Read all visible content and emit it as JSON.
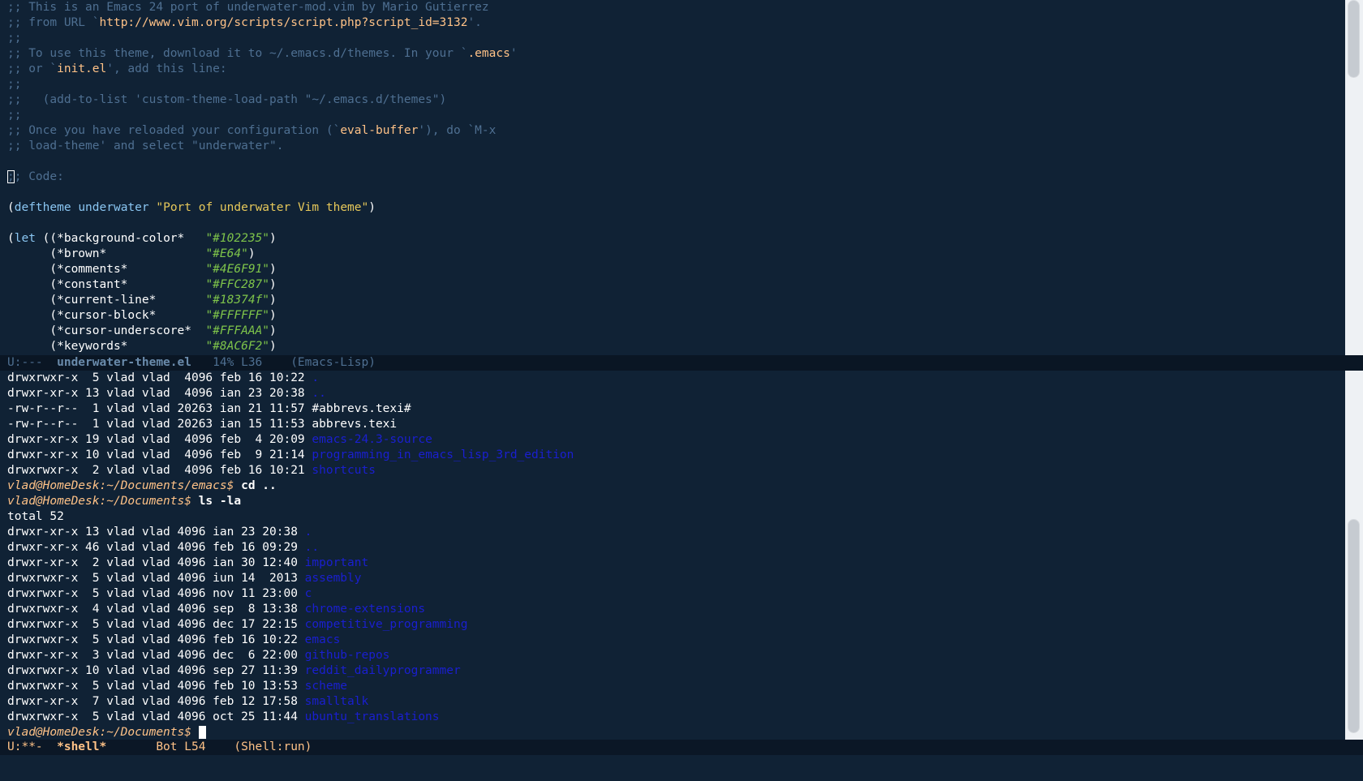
{
  "editor": {
    "lines": {
      "l1": ";; This is an Emacs 24 port of underwater-mod.vim by Mario Gutierrez",
      "l2a": ";; from URL `",
      "l2b": "http://www.vim.org/scripts/script.php?script_id=3132",
      "l2c": "'.",
      "l3": ";;",
      "l4a": ";; To use this theme, download it to ~/.emacs.d/themes. In your `",
      "l4b": ".emacs",
      "l4c": "'",
      "l5a": ";; or `",
      "l5b": "init.el",
      "l5c": "', add this line:",
      "l6": ";;",
      "l7": ";;   (add-to-list 'custom-theme-load-path \"~/.emacs.d/themes\")",
      "l8": ";;",
      "l9a": ";; Once you have reloaded your configuration (`",
      "l9b": "eval-buffer",
      "l9c": "'), do `M-x",
      "l10": ";; load-theme' and select \"underwater\".",
      "l11": "",
      "l12cur": ";",
      "l12": "; Code:",
      "l13": "",
      "l14a": "(",
      "l14b": "deftheme",
      "l14c": " ",
      "l14d": "underwater",
      "l14e": " ",
      "l14f": "\"Port of underwater Vim theme\"",
      "l14g": ")",
      "l15": "",
      "l16a": "(",
      "l16b": "let",
      "l16c": " ((*background-color*   ",
      "l16d": "\"#102235\"",
      "l16e": ")",
      "l17a": "      (*brown*              ",
      "l17b": "\"#E64\"",
      "l17c": ")",
      "l18a": "      (*comments*           ",
      "l18b": "\"#4E6F91\"",
      "l18c": ")",
      "l19a": "      (*constant*           ",
      "l19b": "\"#FFC287\"",
      "l19c": ")",
      "l20a": "      (*current-line*       ",
      "l20b": "\"#18374f\"",
      "l20c": ")",
      "l21a": "      (*cursor-block*       ",
      "l21b": "\"#FFFFFF\"",
      "l21c": ")",
      "l22a": "      (*cursor-underscore*  ",
      "l22b": "\"#FFFAAA\"",
      "l22c": ")",
      "l23a": "      (*keywords*           ",
      "l23b": "\"#8AC6F2\"",
      "l23c": ")"
    },
    "modeline": {
      "status": "U:---  ",
      "buffer": "underwater-theme.el",
      "position": "   14% L36    ",
      "mode": "(Emacs-Lisp)"
    }
  },
  "shell": {
    "lines": {
      "s1a": "drwxrwxr-x  5 vlad vlad  4096 feb 16 10:22 ",
      "s1b": ".",
      "s2a": "drwxr-xr-x 13 vlad vlad  4096 ian 23 20:38 ",
      "s2b": "..",
      "s3": "-rw-r--r--  1 vlad vlad 20263 ian 21 11:57 #abbrevs.texi#",
      "s4": "-rw-r--r--  1 vlad vlad 20263 ian 15 11:53 abbrevs.texi",
      "s5a": "drwxr-xr-x 19 vlad vlad  4096 feb  4 20:09 ",
      "s5b": "emacs-24.3-source",
      "s6a": "drwxr-xr-x 10 vlad vlad  4096 feb  9 21:14 ",
      "s6b": "programming_in_emacs_lisp_3rd_edition",
      "s7a": "drwxrwxr-x  2 vlad vlad  4096 feb 16 10:21 ",
      "s7b": "shortcuts",
      "s8a": "vlad@HomeDesk:~/Documents/emacs$ ",
      "s8b": "cd ..",
      "s9a": "vlad@HomeDesk:~/Documents$ ",
      "s9b": "ls -la",
      "s10": "total 52",
      "s11a": "drwxr-xr-x 13 vlad vlad 4096 ian 23 20:38 ",
      "s11b": ".",
      "s12a": "drwxr-xr-x 46 vlad vlad 4096 feb 16 09:29 ",
      "s12b": "..",
      "s13a": "drwxr-xr-x  2 vlad vlad 4096 ian 30 12:40 ",
      "s13b": "important",
      "s14a": "drwxrwxr-x  5 vlad vlad 4096 iun 14  2013 ",
      "s14b": "assembly",
      "s15a": "drwxrwxr-x  5 vlad vlad 4096 nov 11 23:00 ",
      "s15b": "c",
      "s16a": "drwxrwxr-x  4 vlad vlad 4096 sep  8 13:38 ",
      "s16b": "chrome-extensions",
      "s17a": "drwxrwxr-x  5 vlad vlad 4096 dec 17 22:15 ",
      "s17b": "competitive_programming",
      "s18a": "drwxrwxr-x  5 vlad vlad 4096 feb 16 10:22 ",
      "s18b": "emacs",
      "s19a": "drwxr-xr-x  3 vlad vlad 4096 dec  6 22:00 ",
      "s19b": "github-repos",
      "s20a": "drwxrwxr-x 10 vlad vlad 4096 sep 27 11:39 ",
      "s20b": "reddit_dailyprogrammer",
      "s21a": "drwxrwxr-x  5 vlad vlad 4096 feb 10 13:53 ",
      "s21b": "scheme",
      "s22a": "drwxr-xr-x  7 vlad vlad 4096 feb 12 17:58 ",
      "s22b": "smalltalk",
      "s23a": "drwxrwxr-x  5 vlad vlad 4096 oct 25 11:44 ",
      "s23b": "ubuntu_translations",
      "s24a": "vlad@HomeDesk:~/Documents$ "
    },
    "modeline": {
      "status": "U:**-  ",
      "buffer": "*shell*",
      "position": "       Bot L54    ",
      "mode": "(Shell:run)"
    }
  },
  "colors": {
    "background": "#102235",
    "comments": "#4E6F91",
    "constant": "#FFC287",
    "keywords": "#8AC6F2",
    "directory": "#1a1fd0"
  }
}
